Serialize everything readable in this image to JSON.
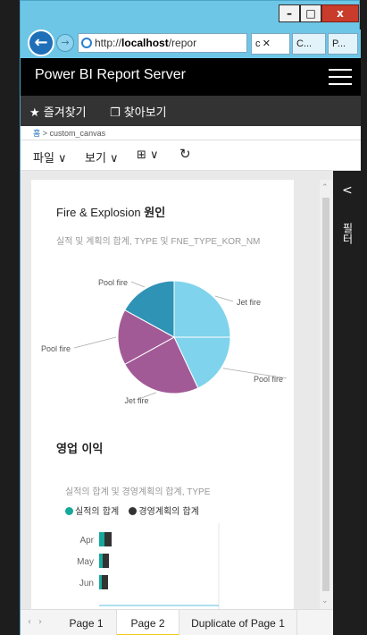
{
  "window": {
    "minimize_label": "–",
    "maximize_label": "□",
    "close_label": "x"
  },
  "address": {
    "url_prefix": "http://",
    "url_host": "localhost",
    "url_rest": "/repor",
    "icons": "⌕ ▾ ↻",
    "tab1_label": "c ✕",
    "tab2_label": "C...",
    "tab3_label": "P..."
  },
  "header": {
    "title": "Power BI Report Server"
  },
  "favorites": {
    "favorites_label": "★ 즐겨찾기",
    "browse_label": "❐ 찾아보기"
  },
  "breadcrumb": {
    "home": "홈",
    "sep": " > ",
    "current": "custom_canvas"
  },
  "toolbar": {
    "file_label": "파일 ∨",
    "view_label": "보기 ∨",
    "comment_label": "⊞ ∨",
    "refresh_icon": "refresh-icon"
  },
  "filter_pane": {
    "chevron": "<",
    "label": "필터"
  },
  "pages": {
    "tabs": [
      "Page 1",
      "Page 2",
      "Duplicate of Page 1"
    ],
    "active": "Page 2"
  },
  "pie_chart": {
    "title_en": "Fire & Explosion ",
    "title_ko": "원인",
    "subtitle": "실적 및 계획의 합계, TYPE 및 FNE_TYPE_KOR_NM",
    "colors": {
      "light": "#7fd3ec",
      "purple": "#a25a96",
      "teal": "#2f93b5"
    }
  },
  "bar_chart": {
    "title": "영업 이익",
    "subtitle": "실적의 합계 및 경영계획의 합계, TYPE",
    "legend": [
      "실적의 합계",
      "경영계획의 합계"
    ],
    "legend_colors": [
      "#16a89a",
      "#333333"
    ]
  },
  "chart_data": [
    {
      "type": "pie",
      "title": "Fire & Explosion 원인",
      "subtitle": "실적 및 계획의 합계, TYPE 및 FNE_TYPE_KOR_NM",
      "slices": [
        {
          "label": "Jet fire",
          "value": 0.25,
          "color": "#7fd3ec"
        },
        {
          "label": "Pool fire",
          "value": 0.18,
          "color": "#7fd3ec"
        },
        {
          "label": "Jet fire",
          "value": 0.24,
          "color": "#a25a96"
        },
        {
          "label": "Pool fire",
          "value": 0.16,
          "color": "#a25a96"
        },
        {
          "label": "Pool fire",
          "value": 0.17,
          "color": "#2f93b5"
        }
      ]
    },
    {
      "type": "bar",
      "title": "영업 이익",
      "subtitle": "실적의 합계 및 경영계획의 합계, TYPE",
      "orientation": "horizontal",
      "categories": [
        "Apr",
        "May",
        "Jun"
      ],
      "series": [
        {
          "name": "실적의 합계",
          "values": [
            3,
            2,
            1.5
          ]
        },
        {
          "name": "경영계획의 합계",
          "values": [
            4,
            3.5,
            3.5
          ]
        }
      ]
    }
  ]
}
